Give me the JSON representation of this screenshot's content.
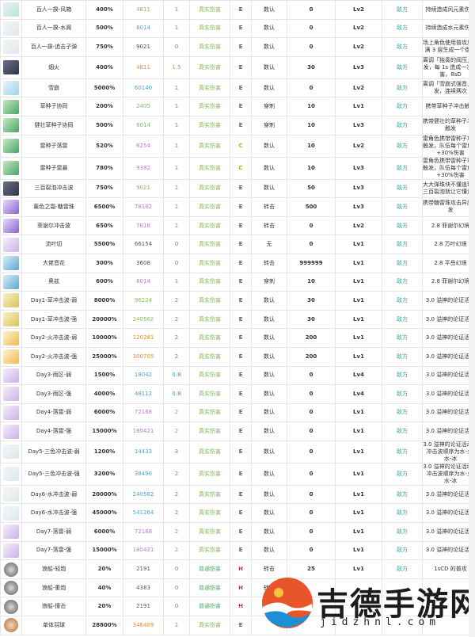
{
  "colors": {
    "value_green": "#7cc35c",
    "value_blue": "#4aa3d8",
    "value_orange": "#f08a2a",
    "value_purple": "#b77ad6",
    "value_gray": "#555555",
    "count_green": "#48a84e",
    "count_blue": "#3b8fd0",
    "dmg_true": "#7fb85a",
    "dmg_normal": "#58a866",
    "grade_E": "#8a3fa0",
    "grade_C": "#c7a02a",
    "grade_H": "#d23a3a",
    "side": "#34a7a0"
  },
  "rows": [
    {
      "icon": "ic-wind",
      "name": "百人一揆-风箱",
      "pct": "400%",
      "val": "4811",
      "vc": "value_green",
      "cnt": "1",
      "cc": "count_green",
      "dmg": "真实伤害",
      "grade": "E",
      "type": "数认",
      "n1": "0",
      "lv": "Lv2",
      "side": "敌方",
      "desc": "持续造成风元素伤害"
    },
    {
      "icon": "ic-pale",
      "name": "百人一揆-水阁",
      "pct": "500%",
      "val": "6014",
      "vc": "value_blue",
      "cnt": "1",
      "cc": "count_green",
      "dmg": "真实伤害",
      "grade": "E",
      "type": "数认",
      "n1": "0",
      "lv": "Lv2",
      "side": "敌方",
      "desc": "持续造成水元素伤害"
    },
    {
      "icon": "ic-pale",
      "name": "百人一揆-追击子弹",
      "pct": "750%",
      "val": "9021",
      "vc": "value_gray",
      "cnt": "0",
      "cc": "count_green",
      "dmg": "真实伤害",
      "grade": "E",
      "type": "数认",
      "n1": "0",
      "lv": "Lv2",
      "side": "敌方",
      "desc": "场上角色使用普攻后叠满 3 层生成一个御弹"
    },
    {
      "icon": "ic-dark",
      "name": "烟火",
      "pct": "400%",
      "val": "4811",
      "vc": "value_orange",
      "cnt": "1.5",
      "cc": "value_orange",
      "dmg": "真实伤害",
      "grade": "E",
      "type": "数认",
      "n1": "30",
      "lv": "Lv3",
      "side": "敌方",
      "desc": "离调「独奏的阈压」触发，每 1s 造成一次伤害，8sD"
    },
    {
      "icon": "ic-ice",
      "name": "雪崩",
      "pct": "5000%",
      "val": "60140",
      "vc": "value_blue",
      "cnt": "1",
      "cc": "count_green",
      "dmg": "真实伤害",
      "grade": "E",
      "type": "数认",
      "n1": "0",
      "lv": "Lv2",
      "side": "敌方",
      "desc": "离调「雪崩式强音」触发，连续两次"
    },
    {
      "icon": "ic-leaf",
      "name": "草种子协同",
      "pct": "200%",
      "val": "2405",
      "vc": "value_green",
      "cnt": "1",
      "cc": "count_green",
      "dmg": "真实伤害",
      "grade": "E",
      "type": "穿刺",
      "n1": "10",
      "lv": "Lv1",
      "side": "敌方",
      "desc": "携带草种子冲击触发"
    },
    {
      "icon": "ic-leaf",
      "name": "健壮草种子协同",
      "pct": "500%",
      "val": "6014",
      "vc": "value_green",
      "cnt": "1",
      "cc": "count_green",
      "dmg": "真实伤害",
      "grade": "E",
      "type": "穿刺",
      "n1": "10",
      "lv": "Lv3",
      "side": "敌方",
      "desc": "携带健壮的草种子冲击触发"
    },
    {
      "icon": "ic-leaf",
      "name": "雷种子落雷",
      "pct": "520%",
      "val": "6254",
      "vc": "value_purple",
      "cnt": "1",
      "cc": "count_green",
      "dmg": "真实伤害",
      "grade": "C",
      "type": "数认",
      "n1": "10",
      "lv": "Lv2",
      "side": "敌方",
      "desc": "雷角色携带雷种子攻击触发，队伍每个雷角色+30%伤害"
    },
    {
      "icon": "ic-leaf",
      "name": "雷种子雷暴",
      "pct": "780%",
      "val": "9382",
      "vc": "value_purple",
      "cnt": "1",
      "cc": "count_green",
      "dmg": "真实伤害",
      "grade": "C",
      "type": "数认",
      "n1": "10",
      "lv": "Lv3",
      "side": "敌方",
      "desc": "雷角色携带雷种子攻击触发，队伍每个雷角色+30%伤害"
    },
    {
      "icon": "ic-dark",
      "name": "三百裂泡冲击波",
      "pct": "750%",
      "val": "9021",
      "vc": "value_green",
      "cnt": "1",
      "cc": "count_green",
      "dmg": "真实伤害",
      "grade": "E",
      "type": "数认",
      "n1": "50",
      "lv": "Lv3",
      "side": "敌方",
      "desc": "大大弹珠块不懂道理，三百裂泡就让它懂道理"
    },
    {
      "icon": "ic-violet",
      "name": "薰色之霜-糖雷珠",
      "pct": "6500%",
      "val": "78182",
      "vc": "value_purple",
      "cnt": "1",
      "cc": "count_green",
      "dmg": "真实伤害",
      "grade": "E",
      "type": "转击",
      "n1": "500",
      "lv": "Lv3",
      "side": "敌方",
      "desc": "携带糖雷珠攻击异魔触发"
    },
    {
      "icon": "ic-violet",
      "name": "菲谢尔冲击波",
      "pct": "650%",
      "val": "7818",
      "vc": "value_purple",
      "cnt": "1",
      "cc": "count_green",
      "dmg": "真实伤害",
      "grade": "E",
      "type": "转击",
      "n1": "0",
      "lv": "Lv2",
      "side": "敌方",
      "desc": "2.8 菲谢尔幻境"
    },
    {
      "icon": "ic-lilac",
      "name": "流叶切",
      "pct": "5500%",
      "val": "66154",
      "vc": "value_gray",
      "cnt": "0",
      "cc": "count_green",
      "dmg": "真实伤害",
      "grade": "E",
      "type": "无",
      "n1": "0",
      "lv": "Lv1",
      "side": "敌方",
      "desc": "2.8 万叶幻境"
    },
    {
      "icon": "ic-aqua",
      "name": "大佬音花",
      "pct": "300%",
      "val": "3608",
      "vc": "value_gray",
      "cnt": "0",
      "cc": "count_green",
      "dmg": "真实伤害",
      "grade": "E",
      "type": "转击",
      "n1": "999999",
      "lv": "Lv1",
      "side": "敌方",
      "desc": "2.8 平岳幻境"
    },
    {
      "icon": "ic-aqua",
      "name": "奥兹",
      "pct": "600%",
      "val": "6014",
      "vc": "value_purple",
      "cnt": "1",
      "cc": "count_green",
      "dmg": "真实伤害",
      "grade": "E",
      "type": "穿刺",
      "n1": "10",
      "lv": "Lv1",
      "side": "敌方",
      "desc": "2.8 菲谢尔幻境"
    },
    {
      "icon": "ic-gold",
      "name": "Day1-草冲击波-弱",
      "pct": "8000%",
      "val": "96224",
      "vc": "value_green",
      "cnt": "2",
      "cc": "count_green",
      "dmg": "真实伤害",
      "grade": "E",
      "type": "数认",
      "n1": "30",
      "lv": "Lv1",
      "side": "敌方",
      "desc": "3.0 溢神的论证活动"
    },
    {
      "icon": "ic-gold",
      "name": "Day1-草冲击波-强",
      "pct": "20000%",
      "val": "240562",
      "vc": "value_green",
      "cnt": "2",
      "cc": "count_green",
      "dmg": "真实伤害",
      "grade": "E",
      "type": "数认",
      "n1": "30",
      "lv": "Lv1",
      "side": "敌方",
      "desc": "3.0 溢神的论证活动"
    },
    {
      "icon": "ic-fire",
      "name": "Day2-火冲击波-弱",
      "pct": "10000%",
      "val": "120281",
      "vc": "value_orange",
      "cnt": "2",
      "cc": "count_green",
      "dmg": "真实伤害",
      "grade": "E",
      "type": "数认",
      "n1": "200",
      "lv": "Lv1",
      "side": "敌方",
      "desc": "3.0 溢神的论证活动"
    },
    {
      "icon": "ic-fire",
      "name": "Day2-火冲击波-强",
      "pct": "25000%",
      "val": "300705",
      "vc": "value_orange",
      "cnt": "2",
      "cc": "count_green",
      "dmg": "真实伤害",
      "grade": "E",
      "type": "数认",
      "n1": "200",
      "lv": "Lv1",
      "side": "敌方",
      "desc": "3.0 溢神的论证活动"
    },
    {
      "icon": "ic-lilac",
      "name": "Day3-雨区-弱",
      "pct": "1500%",
      "val": "18042",
      "vc": "value_blue",
      "cnt": "0.8",
      "cc": "count_blue",
      "dmg": "真实伤害",
      "grade": "E",
      "type": "数认",
      "n1": "0",
      "lv": "Lv4",
      "side": "敌方",
      "desc": "3.0 溢神的论证活动"
    },
    {
      "icon": "ic-lilac",
      "name": "Day3-雨区-强",
      "pct": "4000%",
      "val": "48112",
      "vc": "value_blue",
      "cnt": "0.8",
      "cc": "count_blue",
      "dmg": "真实伤害",
      "grade": "E",
      "type": "数认",
      "n1": "0",
      "lv": "Lv4",
      "side": "敌方",
      "desc": "3.0 溢神的论证活动"
    },
    {
      "icon": "ic-lilac",
      "name": "Day4-落雷-弱",
      "pct": "6000%",
      "val": "72168",
      "vc": "value_purple",
      "cnt": "2",
      "cc": "value_purple",
      "dmg": "真实伤害",
      "grade": "E",
      "type": "数认",
      "n1": "0",
      "lv": "Lv1",
      "side": "敌方",
      "desc": "3.0 溢神的论证活动"
    },
    {
      "icon": "ic-lilac",
      "name": "Day4-落雷-强",
      "pct": "15000%",
      "val": "180421",
      "vc": "value_purple",
      "cnt": "2",
      "cc": "value_purple",
      "dmg": "真实伤害",
      "grade": "E",
      "type": "数认",
      "n1": "0",
      "lv": "Lv1",
      "side": "敌方",
      "desc": "3.0 溢神的论证活动"
    },
    {
      "icon": "ic-pale",
      "name": "Day5-三色冲击波-弱",
      "pct": "1200%",
      "val": "14433",
      "vc": "value_blue",
      "cnt": "3",
      "cc": "count_green",
      "dmg": "真实伤害",
      "grade": "E",
      "type": "数认",
      "n1": "0",
      "lv": "Lv1",
      "side": "敌方",
      "desc": "3.0 溢神的论证活动，冲击波顺序为水-火-水-冰"
    },
    {
      "icon": "ic-pale",
      "name": "Day5-三色冲击波-强",
      "pct": "3200%",
      "val": "38490",
      "vc": "value_blue",
      "cnt": "2",
      "cc": "count_green",
      "dmg": "真实伤害",
      "grade": "E",
      "type": "数认",
      "n1": "0",
      "lv": "Lv1",
      "side": "敌方",
      "desc": "3.0 溢神的论证活动，冲击波顺序为水-火-水-冰"
    },
    {
      "icon": "ic-pale",
      "name": "Day6-水冲击波-弱",
      "pct": "20000%",
      "val": "240562",
      "vc": "value_blue",
      "cnt": "2",
      "cc": "count_green",
      "dmg": "真实伤害",
      "grade": "E",
      "type": "数认",
      "n1": "0",
      "lv": "Lv1",
      "side": "敌方",
      "desc": "3.0 溢神的论证活动"
    },
    {
      "icon": "ic-pale",
      "name": "Day6-水冲击波-强",
      "pct": "45000%",
      "val": "541264",
      "vc": "value_blue",
      "cnt": "2",
      "cc": "count_green",
      "dmg": "真实伤害",
      "grade": "E",
      "type": "数认",
      "n1": "0",
      "lv": "Lv1",
      "side": "敌方",
      "desc": "3.0 溢神的论证活动"
    },
    {
      "icon": "ic-lilac",
      "name": "Day7-落雷-弱",
      "pct": "6000%",
      "val": "72168",
      "vc": "value_purple",
      "cnt": "2",
      "cc": "value_purple",
      "dmg": "真实伤害",
      "grade": "E",
      "type": "数认",
      "n1": "0",
      "lv": "Lv1",
      "side": "敌方",
      "desc": "3.0 溢神的论证活动"
    },
    {
      "icon": "ic-lilac",
      "name": "Day7-落雷-强",
      "pct": "15000%",
      "val": "180421",
      "vc": "value_purple",
      "cnt": "2",
      "cc": "value_purple",
      "dmg": "真实伤害",
      "grade": "E",
      "type": "数认",
      "n1": "0",
      "lv": "Lv1",
      "side": "敌方",
      "desc": "3.0 溢神的论证活动"
    },
    {
      "icon": "ic-round",
      "name": "浪船-轻炮",
      "pct": "20%",
      "val": "2191",
      "vc": "value_gray",
      "cnt": "0",
      "cc": "count_green",
      "dmg": "普通伤害",
      "grade": "H",
      "type": "转击",
      "n1": "25",
      "lv": "Lv1",
      "side": "敌方",
      "desc": "1sCD 的普攻"
    },
    {
      "icon": "ic-round",
      "name": "浪船-重炮",
      "pct": "40%",
      "val": "4383",
      "vc": "value_gray",
      "cnt": "0",
      "cc": "count_green",
      "dmg": "普通伤害",
      "grade": "H",
      "type": "转击",
      "n1": "",
      "lv": "",
      "side": "",
      "desc": ""
    },
    {
      "icon": "ic-round",
      "name": "浪船-撞击",
      "pct": "20%",
      "val": "2191",
      "vc": "value_gray",
      "cnt": "0",
      "cc": "count_green",
      "dmg": "普通伤害",
      "grade": "H",
      "type": "",
      "n1": "",
      "lv": "",
      "side": "",
      "desc": ""
    },
    {
      "icon": "ic-round-o",
      "name": "单体羽球",
      "pct": "28800%",
      "val": "346409",
      "vc": "value_orange",
      "cnt": "1",
      "cc": "count_green",
      "dmg": "真实伤害",
      "grade": "E",
      "type": "",
      "n1": "",
      "lv": "",
      "side": "",
      "desc": ""
    }
  ],
  "watermark": {
    "text": "吉德手游网",
    "domain": "jidzhnl.com"
  }
}
